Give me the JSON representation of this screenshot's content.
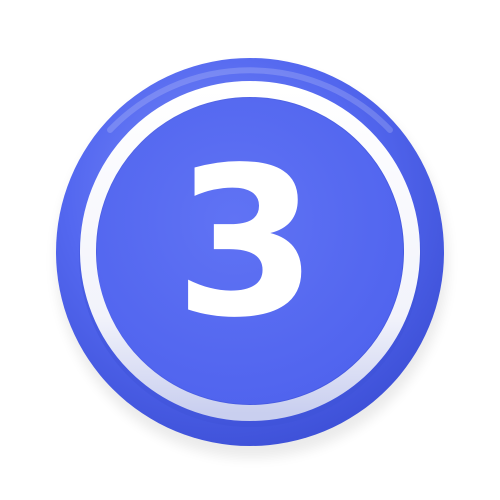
{
  "badge": {
    "numeral": "3",
    "colors": {
      "background": "#ffffff",
      "disc": "#5468f0",
      "disc_highlight": "#7c8df7",
      "disc_shadow": "#3c4fd6",
      "ring": "#ffffff",
      "ring_shadow": "#c9cfef",
      "numeral": "#ffffff"
    }
  }
}
